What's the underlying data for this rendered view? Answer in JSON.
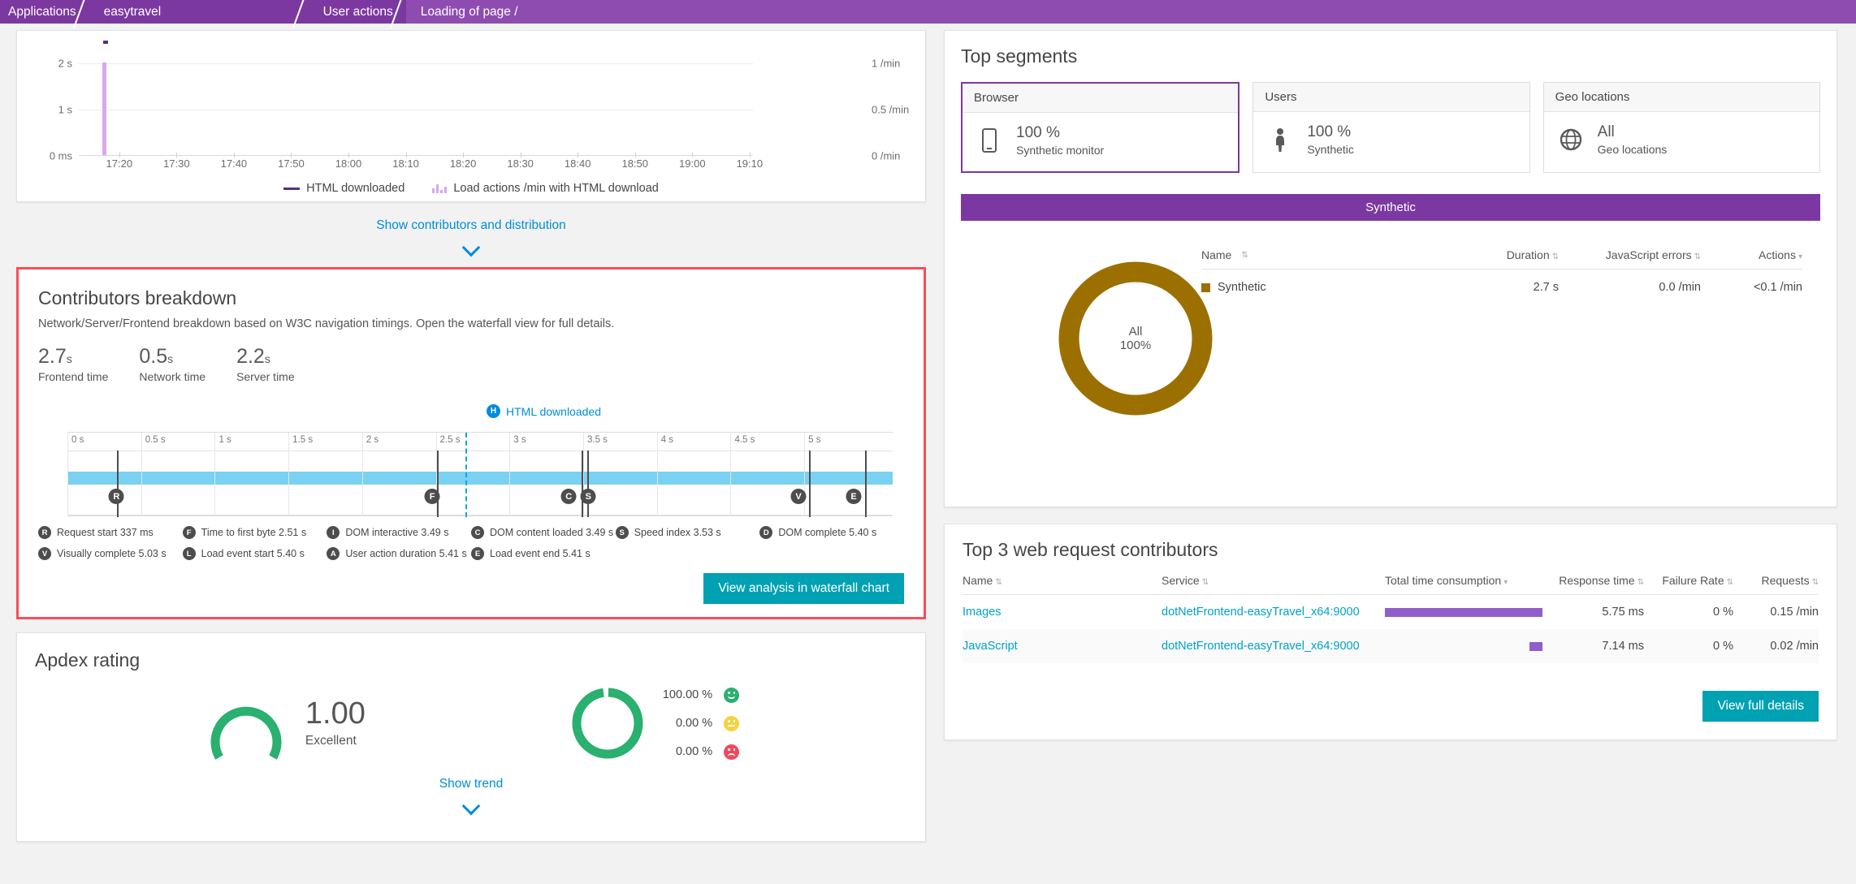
{
  "breadcrumb": [
    {
      "label": "Applications"
    },
    {
      "label": "easytravel"
    },
    {
      "label": "User actions"
    },
    {
      "label": "Loading of page /"
    }
  ],
  "top_chart": {
    "legend": [
      {
        "label": "HTML downloaded",
        "type": "line",
        "color": "#5b2d82"
      },
      {
        "label": "Load actions /min with HTML download",
        "type": "bars",
        "color": "#d9a8ea"
      }
    ],
    "show_link": "Show contributors and distribution",
    "chart_data": {
      "type": "bar",
      "title": "",
      "xlabel": "",
      "ylabel": "",
      "y_left_ticks": [
        "2 s",
        "1 s",
        "0 ms"
      ],
      "y_right_ticks": [
        "1 /min",
        "0.5 /min",
        "0 /min"
      ],
      "categories": [
        "17:20",
        "17:30",
        "17:40",
        "17:50",
        "18:00",
        "18:10",
        "18:20",
        "18:30",
        "18:40",
        "18:50",
        "19:00",
        "19:10"
      ],
      "x": [
        "17:12"
      ],
      "values": [
        1.0
      ],
      "ylim_left": [
        0,
        2.6
      ],
      "ylim_right": [
        0,
        1.3
      ],
      "series": [
        {
          "name": "Load actions /min with HTML download",
          "values": [
            1.0
          ]
        },
        {
          "name": "HTML downloaded",
          "values": [
            2.55
          ]
        }
      ],
      "grid": true,
      "legend_position": "bottom"
    }
  },
  "contributors": {
    "title": "Contributors breakdown",
    "description": "Network/Server/Frontend breakdown based on W3C navigation timings. Open the waterfall view for full details.",
    "metrics": [
      {
        "value": "2.7",
        "unit": "s",
        "label": "Frontend time"
      },
      {
        "value": "0.5",
        "unit": "s",
        "label": "Network time"
      },
      {
        "value": "2.2",
        "unit": "s",
        "label": "Server time"
      }
    ],
    "html_flag": {
      "badge": "H",
      "label": "HTML downloaded",
      "at_seconds": 2.7
    },
    "axis_ticks": [
      "0 s",
      "0.5 s",
      "1 s",
      "1.5 s",
      "2 s",
      "2.5 s",
      "3 s",
      "3.5 s",
      "4 s",
      "4.5 s",
      "5 s"
    ],
    "axis_max_seconds": 5.6,
    "markers": [
      {
        "badge": "R",
        "label": "Request start 337 ms",
        "at_seconds": 0.337
      },
      {
        "badge": "F",
        "label": "Time to first byte 2.51 s",
        "at_seconds": 2.51
      },
      {
        "badge": "I",
        "label": "DOM interactive 3.49 s",
        "at_seconds": 3.49
      },
      {
        "badge": "C",
        "label": "DOM content loaded 3.49 s",
        "at_seconds": 3.49
      },
      {
        "badge": "S",
        "label": "Speed index 3.53 s",
        "at_seconds": 3.53
      },
      {
        "badge": "V",
        "label": "Visually complete 5.03 s",
        "at_seconds": 5.03
      },
      {
        "badge": "L",
        "label": "Load event start 5.40 s",
        "at_seconds": 5.4
      },
      {
        "badge": "A",
        "label": "User action duration 5.41 s",
        "at_seconds": 5.41
      },
      {
        "badge": "E",
        "label": "Load event end 5.41 s",
        "at_seconds": 5.41
      },
      {
        "badge": "D",
        "label": "DOM complete 5.40 s",
        "at_seconds": 5.4
      }
    ],
    "waterfall_button": "View analysis in waterfall chart",
    "highlight_color": "#fa4d56"
  },
  "apdex": {
    "title": "Apdex rating",
    "score": "1.00",
    "rating": "Excellent",
    "distribution": [
      {
        "pct": "100.00 %",
        "mood": "satisfied",
        "color": "#2ab06f"
      },
      {
        "pct": "0.00 %",
        "mood": "tolerating",
        "color": "#f5d33f"
      },
      {
        "pct": "0.00 %",
        "mood": "frustrated",
        "color": "#ef4a5a"
      }
    ],
    "show_trend": "Show trend"
  },
  "top_segments": {
    "title": "Top segments",
    "cards": [
      {
        "header": "Browser",
        "icon": "mobile-icon",
        "value": "100 %",
        "caption": "Synthetic monitor",
        "selected": true
      },
      {
        "header": "Users",
        "icon": "person-icon",
        "value": "100 %",
        "caption": "Synthetic",
        "selected": false
      },
      {
        "header": "Geo locations",
        "icon": "globe-icon",
        "value": "All",
        "caption": "Geo locations",
        "selected": false
      }
    ],
    "banner": "Synthetic",
    "table": {
      "columns": [
        "Name",
        "Duration",
        "JavaScript errors",
        "Actions"
      ],
      "rows": [
        {
          "name": "Synthetic",
          "duration": "2.7 s",
          "js_errors": "0.0 /min",
          "actions": "<0.1 /min",
          "color": "#9c7000"
        }
      ]
    },
    "donut": {
      "center_top": "All",
      "center_bottom": "100%",
      "color": "#9c7000",
      "percent": 100
    }
  },
  "top_requests": {
    "title": "Top 3 web request contributors",
    "columns": [
      "Name",
      "Service",
      "Total time consumption",
      "Response time",
      "Failure Rate",
      "Requests"
    ],
    "rows": [
      {
        "name": "Images",
        "service": "dotNetFrontend-easyTravel_x64:9000",
        "bar_pct": 100,
        "response_time": "5.75 ms",
        "failure_rate": "0 %",
        "requests": "0.15 /min"
      },
      {
        "name": "JavaScript",
        "service": "dotNetFrontend-easyTravel_x64:9000",
        "bar_pct": 8,
        "response_time": "7.14 ms",
        "failure_rate": "0 %",
        "requests": "0.02 /min"
      }
    ],
    "button": "View full details",
    "bar_color": "#8f5fc9"
  }
}
